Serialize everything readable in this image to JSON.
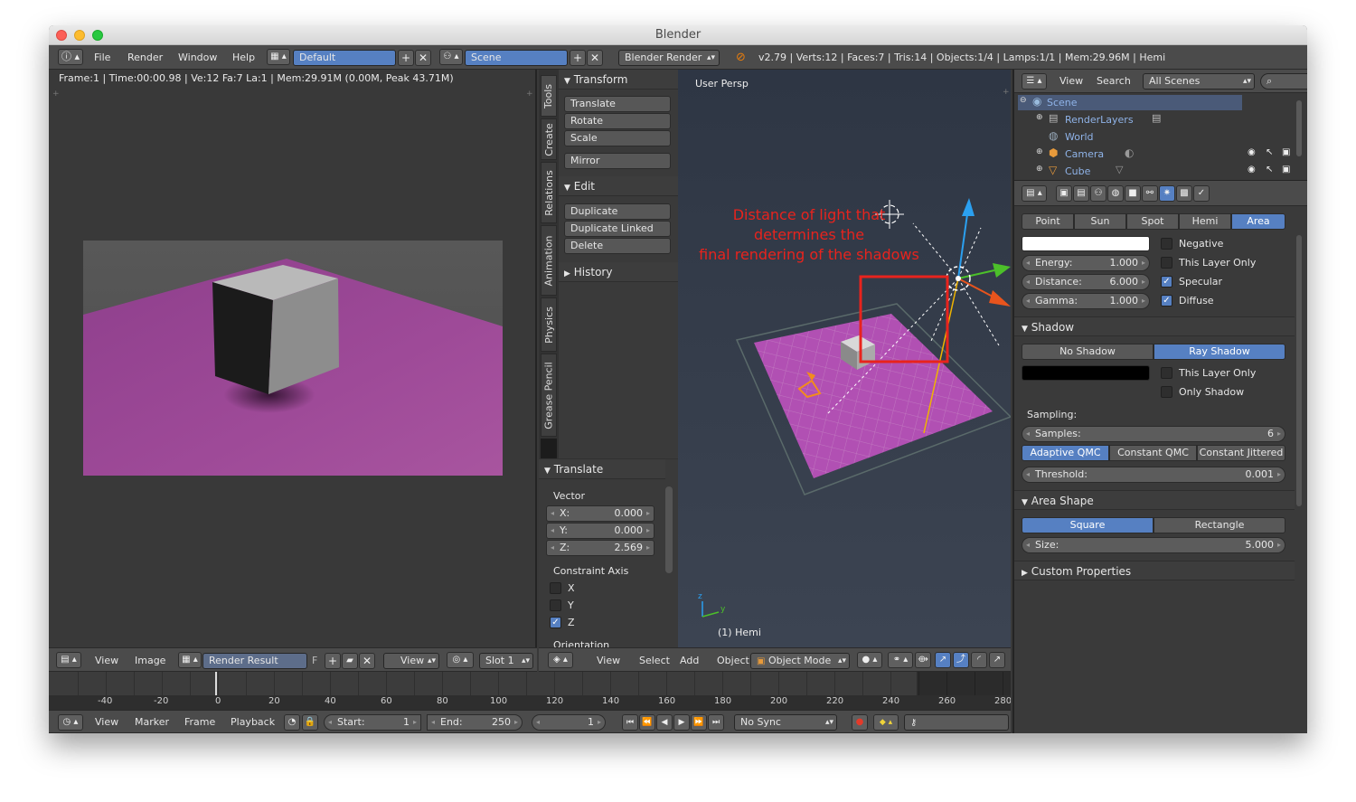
{
  "window": {
    "title": "Blender"
  },
  "info_header": {
    "menus": [
      "File",
      "Render",
      "Window",
      "Help"
    ],
    "screen_layout": "Default",
    "scene": "Scene",
    "engine": "Blender Render",
    "stats": "v2.79 | Verts:12 | Faces:7 | Tris:14 | Objects:1/4 | Lamps:1/1 | Mem:29.96M | Hemi"
  },
  "image_editor": {
    "frame_info": "Frame:1 | Time:00:00.98 | Ve:12 Fa:7 La:1 | Mem:29.91M (0.00M, Peak 43.71M)",
    "header": {
      "view": "View",
      "image": "Image",
      "image_name": "Render Result",
      "fake_user": "F",
      "view_dropdown": "View",
      "slot": "Slot 1"
    }
  },
  "toolshelf": {
    "tabs": [
      "Tools",
      "Create",
      "Relations",
      "Animation",
      "Physics",
      "Grease Pencil"
    ],
    "transform_title": "Transform",
    "transform_buttons": [
      "Translate",
      "Rotate",
      "Scale"
    ],
    "mirror": "Mirror",
    "edit_title": "Edit",
    "edit_buttons": [
      "Duplicate",
      "Duplicate Linked",
      "Delete"
    ],
    "history_title": "History"
  },
  "operator_panel": {
    "title": "Translate",
    "vector_label": "Vector",
    "x_label": "X:",
    "x_value": "0.000",
    "y_label": "Y:",
    "y_value": "0.000",
    "z_label": "Z:",
    "z_value": "2.569",
    "constraint_label": "Constraint Axis",
    "axis_x": "X",
    "axis_y": "Y",
    "axis_z": "Z",
    "orientation_label": "Orientation"
  },
  "viewport": {
    "view_name": "User Persp",
    "annotation_lines": [
      "Distance of light that",
      "determines the",
      "final rendering of the shadows"
    ],
    "object_label": "(1) Hemi",
    "axis_y": "y",
    "axis_z": "z",
    "header": {
      "view": "View",
      "select": "Select",
      "add": "Add",
      "object": "Object",
      "mode": "Object Mode"
    }
  },
  "outliner": {
    "header": {
      "view": "View",
      "search": "Search",
      "filter": "All Scenes"
    },
    "items": [
      "Scene",
      "RenderLayers",
      "World",
      "Camera",
      "Cube"
    ]
  },
  "properties": {
    "lamp_types": [
      "Point",
      "Sun",
      "Spot",
      "Hemi",
      "Area"
    ],
    "active_lamp_type": "Area",
    "negative": "Negative",
    "this_layer_only": "This Layer Only",
    "specular": "Specular",
    "diffuse": "Diffuse",
    "energy_label": "Energy:",
    "energy_value": "1.000",
    "distance_label": "Distance:",
    "distance_value": "6.000",
    "gamma_label": "Gamma:",
    "gamma_value": "1.000",
    "shadow_title": "Shadow",
    "no_shadow": "No Shadow",
    "ray_shadow": "Ray Shadow",
    "shadow_this_layer_only": "This Layer Only",
    "only_shadow": "Only Shadow",
    "sampling_label": "Sampling:",
    "samples_label": "Samples:",
    "samples_value": "6",
    "sampling_methods": [
      "Adaptive QMC",
      "Constant QMC",
      "Constant Jittered"
    ],
    "threshold_label": "Threshold:",
    "threshold_value": "0.001",
    "area_shape_title": "Area Shape",
    "shape_square": "Square",
    "shape_rectangle": "Rectangle",
    "size_label": "Size:",
    "size_value": "5.000",
    "custom_properties": "Custom Properties"
  },
  "timeline": {
    "ticks": [
      "-40",
      "-20",
      "0",
      "20",
      "40",
      "60",
      "80",
      "100",
      "120",
      "140",
      "160",
      "180",
      "200",
      "220",
      "240",
      "260",
      "280"
    ],
    "menus": [
      "View",
      "Marker",
      "Frame",
      "Playback"
    ],
    "start_label": "Start:",
    "start_value": "1",
    "end_label": "End:",
    "end_value": "250",
    "current_frame": "1",
    "sync": "No Sync"
  },
  "colors": {
    "accent": "#5680c2",
    "annotation": "#e8231d",
    "plane": "#a54ea0"
  }
}
